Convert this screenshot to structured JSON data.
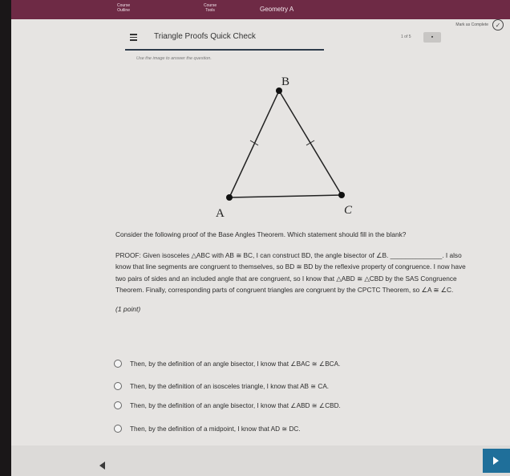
{
  "app": {
    "course_title": "Geometry A"
  },
  "nav": [
    {
      "line1": "Course",
      "line2": "Outline"
    },
    {
      "line1": "Course",
      "line2": "Tools"
    }
  ],
  "status": {
    "mark_label": "Mark as Complete"
  },
  "header": {
    "title": "Triangle Proofs Quick Check",
    "page_count": "1 of 5",
    "page_button": "▪"
  },
  "instruction": "Use the image to answer the question.",
  "figure": {
    "vertex_b": "B",
    "vertex_a": "A",
    "vertex_c": "C"
  },
  "question": {
    "prompt": "Consider the following proof of the Base Angles Theorem. Which statement should fill in the blank?",
    "proof": "PROOF: Given isosceles △ABC with AB ≅ BC, I can construct BD, the angle bisector of ∠B. ______________. I also know that line segments are congruent to themselves, so BD ≅ BD by the reflexive property of congruence. I now have two pairs of sides and an included angle that are congruent, so I know that △ABD ≅ △CBD by the SAS Congruence Theorem. Finally, corresponding parts of congruent triangles are congruent by the CPCTC Theorem, so ∠A ≅ ∠C.",
    "points": "(1 point)"
  },
  "choices": [
    "Then, by the definition of an angle bisector, I know that ∠BAC ≅ ∠BCA.",
    "Then, by the definition of an isosceles triangle, I know that AB ≅ CA.",
    "Then, by the definition of an angle bisector, I know that ∠ABD ≅ ∠CBD.",
    "Then, by the definition of a midpoint, I know that AD ≅ DC."
  ],
  "colors": {
    "topbar": "#6e2a45",
    "next_button": "#1f6f9a",
    "header_rule": "#2e3b4a"
  },
  "icons": {
    "menu": "hamburger-icon",
    "mark": "check-circle-icon",
    "prev": "left-arrow-icon",
    "next": "right-arrow-icon"
  }
}
